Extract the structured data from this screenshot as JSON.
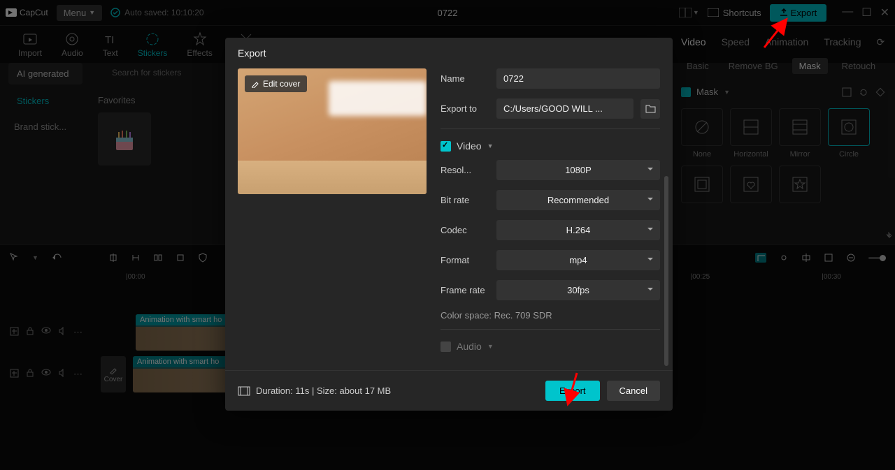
{
  "app": {
    "logo_text": "CapCut",
    "menu": "Menu",
    "autosave": "Auto saved: 10:10:20",
    "project": "0722"
  },
  "titlebar": {
    "shortcuts": "Shortcuts",
    "export": "Export"
  },
  "tabs": {
    "import": "Import",
    "audio": "Audio",
    "text": "Text",
    "stickers": "Stickers",
    "effects": "Effects",
    "transitions": "Trans..."
  },
  "sidebar": {
    "ai": "AI generated",
    "stickers": "Stickers",
    "brand": "Brand stick..."
  },
  "stickers": {
    "search_ph": "Search for stickers",
    "favorites": "Favorites"
  },
  "right": {
    "tabs": {
      "video": "Video",
      "speed": "Speed",
      "animation": "Animation",
      "tracking": "Tracking"
    },
    "subtabs": {
      "basic": "Basic",
      "removebg": "Remove BG",
      "mask": "Mask",
      "retouch": "Retouch"
    },
    "mask_label": "Mask",
    "masks": {
      "none": "None",
      "horizontal": "Horizontal",
      "mirror": "Mirror",
      "circle": "Circle"
    }
  },
  "timeline": {
    "ticks": [
      "|00:00",
      "|00:25",
      "|00:30"
    ],
    "clip1": "Animation with smart ho",
    "clip2": "Animation with smart ho",
    "cover": "Cover"
  },
  "modal": {
    "title": "Export",
    "edit_cover": "Edit cover",
    "name_label": "Name",
    "name_value": "0722",
    "export_to_label": "Export to",
    "export_to_value": "C:/Users/GOOD WILL ...",
    "video_section": "Video",
    "resolution_label": "Resol...",
    "resolution": "1080P",
    "bitrate_label": "Bit rate",
    "bitrate": "Recommended",
    "codec_label": "Codec",
    "codec": "H.264",
    "format_label": "Format",
    "format": "mp4",
    "fps_label": "Frame rate",
    "fps": "30fps",
    "colorspace": "Color space: Rec. 709 SDR",
    "audio_section": "Audio",
    "footer_info": "Duration: 11s | Size: about 17 MB",
    "export_btn": "Export",
    "cancel_btn": "Cancel"
  }
}
